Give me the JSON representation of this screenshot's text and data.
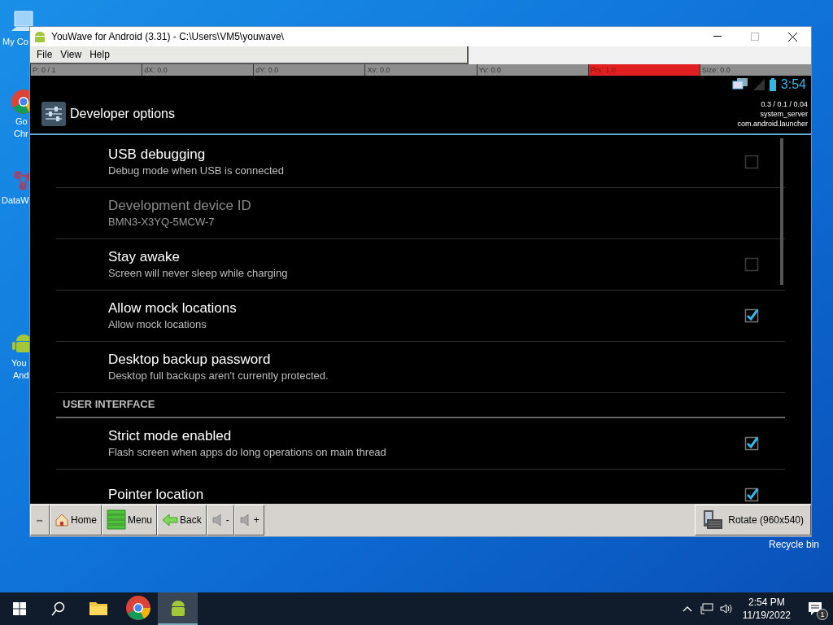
{
  "desktop_icons": [
    {
      "kind": "computer",
      "lines": [
        "My Co"
      ]
    },
    {
      "kind": "chrome",
      "lines": [
        "Go",
        "Chr"
      ]
    },
    {
      "kind": "molecule",
      "lines": [
        "DataW"
      ]
    },
    {
      "kind": "android",
      "lines": [
        "You",
        "And"
      ]
    }
  ],
  "recycle_bin_label": "Recycle bin",
  "window": {
    "title": "YouWave for Android (3.31) - C:\\Users\\VM5\\youwave\\",
    "menu": [
      "File",
      "View",
      "Help"
    ],
    "stats": [
      {
        "label": "P: 0 / 1",
        "highlight": false
      },
      {
        "label": "dX: 0.0",
        "highlight": false
      },
      {
        "label": "dY: 0.0",
        "highlight": false
      },
      {
        "label": "Xv: 0.0",
        "highlight": false
      },
      {
        "label": "Yv: 0.0",
        "highlight": false
      },
      {
        "label": "Prs: 1.0",
        "highlight": true
      },
      {
        "label": "Size: 0.0",
        "highlight": false
      }
    ],
    "android": {
      "clock": "3:54",
      "title": "Developer options",
      "overlay": [
        "0.3 / 0.1 / 0.04",
        "system_server",
        "com.android.launcher"
      ],
      "rows": [
        {
          "kind": "checkbox",
          "title": "USB debugging",
          "summary": "Debug mode when USB is connected",
          "checked": false,
          "disabled": false
        },
        {
          "kind": "plain",
          "title": "Development device ID",
          "summary": "BMN3-X3YQ-5MCW-7",
          "disabled": true
        },
        {
          "kind": "checkbox",
          "title": "Stay awake",
          "summary": "Screen will never sleep while charging",
          "checked": false,
          "disabled": false
        },
        {
          "kind": "checkbox",
          "title": "Allow mock locations",
          "summary": "Allow mock locations",
          "checked": true,
          "disabled": false
        },
        {
          "kind": "plain",
          "title": "Desktop backup password",
          "summary": "Desktop full backups aren't currently protected.",
          "disabled": false
        },
        {
          "kind": "header",
          "title": "USER INTERFACE"
        },
        {
          "kind": "checkbox",
          "title": "Strict mode enabled",
          "summary": "Flash screen when apps do long operations on main thread",
          "checked": true,
          "disabled": false
        },
        {
          "kind": "checkbox",
          "title": "Pointer location",
          "checked": true,
          "disabled": false
        }
      ]
    },
    "toolbar": [
      {
        "kind": "resize",
        "label": "⇔"
      },
      {
        "kind": "home",
        "label": "Home"
      },
      {
        "kind": "menu",
        "label": "Menu"
      },
      {
        "kind": "back",
        "label": "Back"
      },
      {
        "kind": "vol",
        "label": "-"
      },
      {
        "kind": "vol",
        "label": "+"
      }
    ],
    "rotate": "Rotate (960x540)"
  },
  "taskbar": {
    "apps": [
      {
        "kind": "explorer",
        "selected": false
      },
      {
        "kind": "chrome",
        "selected": false
      },
      {
        "kind": "android",
        "selected": true
      }
    ],
    "time": "2:54 PM",
    "date": "11/19/2022",
    "notifications": "1"
  }
}
